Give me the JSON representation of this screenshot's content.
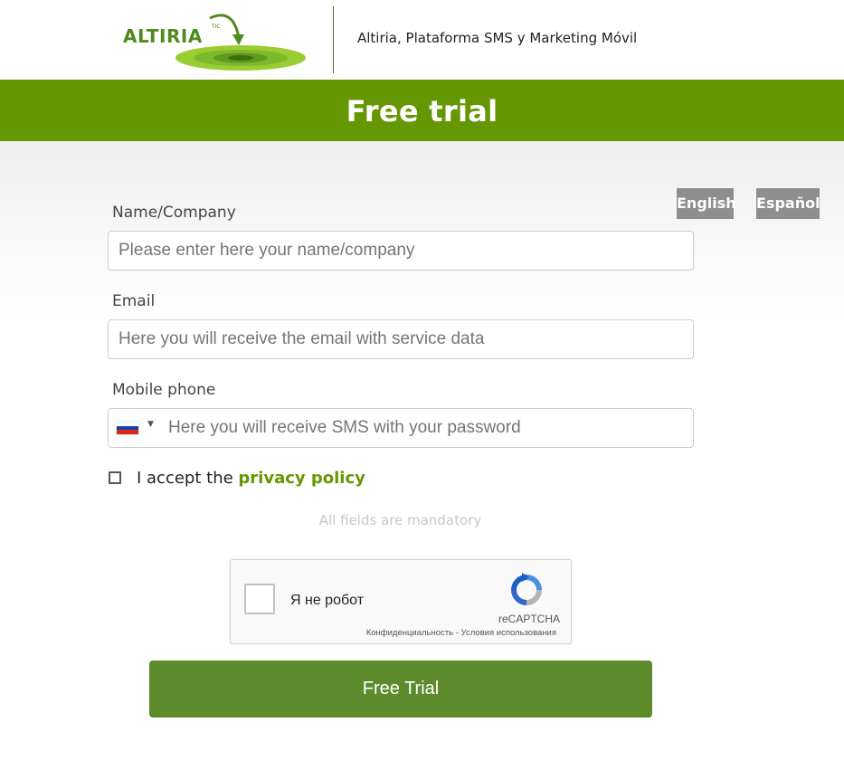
{
  "header": {
    "logo_text": "ALTIRIA",
    "logo_tm": "TIC",
    "tagline": "Altiria, Plataforma SMS y Marketing Móvil"
  },
  "banner": {
    "title": "Free trial"
  },
  "languages": {
    "english": "English",
    "spanish": "Español"
  },
  "form": {
    "name": {
      "label": "Name/Company",
      "placeholder": "Please enter here your name/company"
    },
    "email": {
      "label": "Email",
      "placeholder": "Here you will receive the email with service data"
    },
    "phone": {
      "label": "Mobile phone",
      "placeholder": "Here you will receive SMS with your password",
      "country_flag": "russia-flag-icon"
    },
    "privacy": {
      "prefix": "I accept the ",
      "link": "privacy policy",
      "checked": false
    },
    "mandatory_note": "All fields are mandatory",
    "submit_label": "Free Trial"
  },
  "captcha": {
    "label": "Я не робот",
    "brand": "reCAPTCHA",
    "privacy": "Конфиденциальность",
    "separator": " - ",
    "terms": "Условия использования"
  },
  "colors": {
    "brand_green": "#659703",
    "button_green": "#5d8a2b",
    "lang_gray": "#8e8e8e"
  }
}
